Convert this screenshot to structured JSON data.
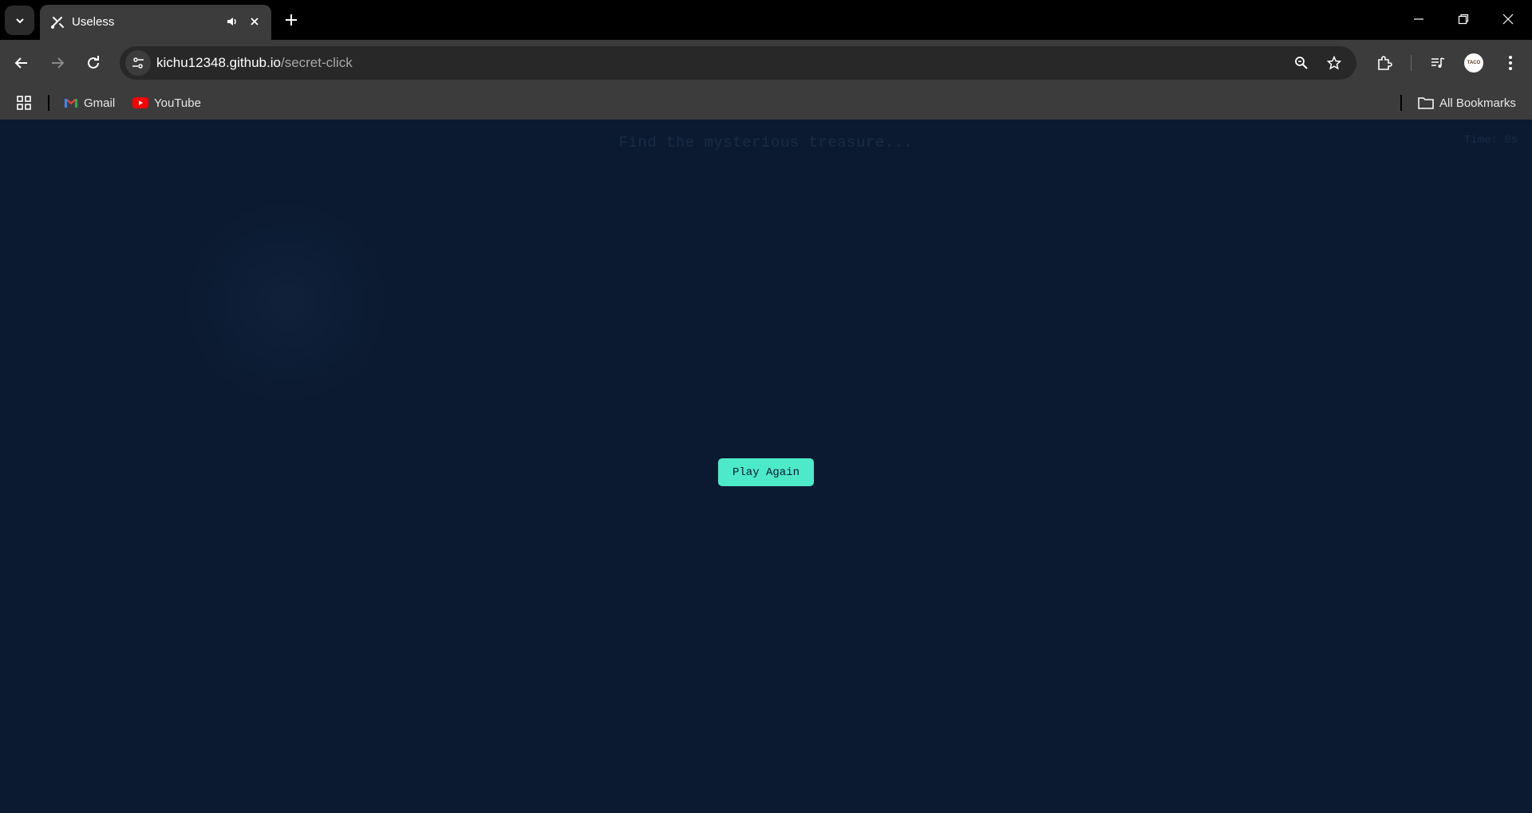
{
  "browser": {
    "tab": {
      "title": "Useless"
    },
    "address": {
      "host": "kichu12348.github.io",
      "path": "/secret-click"
    },
    "bookmarks": [
      {
        "label": "Gmail",
        "icon": "gmail-icon"
      },
      {
        "label": "YouTube",
        "icon": "youtube-icon"
      }
    ],
    "all_bookmarks_label": "All Bookmarks",
    "avatar_text": "TACO"
  },
  "page": {
    "hint": "Find the mysterious treasure...",
    "timer": "Time: 0s",
    "play_again_label": "Play Again"
  },
  "colors": {
    "page_bg": "#0b1a31",
    "button_accent": "#4deac9",
    "chrome_bg": "#3c3c3c"
  }
}
